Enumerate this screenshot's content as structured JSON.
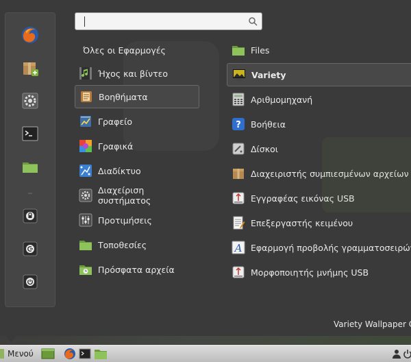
{
  "search": {
    "value": "",
    "placeholder": ""
  },
  "favorites": [
    {
      "name": "firefox-icon"
    },
    {
      "name": "software-manager-icon"
    },
    {
      "name": "system-settings-icon"
    },
    {
      "name": "terminal-icon"
    },
    {
      "name": "folder-icon"
    },
    {
      "name": "lock-screen-icon"
    },
    {
      "name": "logout-icon"
    },
    {
      "name": "shutdown-icon"
    }
  ],
  "categories": [
    {
      "label": "Όλες οι Εφαρμογές",
      "icon": ""
    },
    {
      "label": "Ήχος και βίντεο",
      "icon": "multimedia-icon"
    },
    {
      "label": "Βοηθήματα",
      "icon": "accessories-icon"
    },
    {
      "label": "Γραφείο",
      "icon": "office-icon"
    },
    {
      "label": "Γραφικά",
      "icon": "graphics-icon"
    },
    {
      "label": "Διαδίκτυο",
      "icon": "internet-icon"
    },
    {
      "label": "Διαχείριση συστήματος",
      "icon": "administration-icon"
    },
    {
      "label": "Προτιμήσεις",
      "icon": "preferences-icon"
    },
    {
      "label": "Τοποθεσίες",
      "icon": "places-folder-icon"
    },
    {
      "label": "Πρόσφατα αρχεία",
      "icon": "recent-files-icon"
    }
  ],
  "selected_category": "Βοηθήματα",
  "apps": [
    {
      "label": "Files",
      "icon": "folder-icon"
    },
    {
      "label": "Variety",
      "icon": "variety-icon"
    },
    {
      "label": "Αριθμομηχανή",
      "icon": "calculator-icon"
    },
    {
      "label": "Βοήθεια",
      "icon": "help-icon"
    },
    {
      "label": "Δίσκοι",
      "icon": "disks-icon"
    },
    {
      "label": "Διαχειριστής συμπιεσμένων αρχείων",
      "icon": "archive-manager-icon"
    },
    {
      "label": "Εγγραφέας εικόνας USB",
      "icon": "usb-image-writer-icon"
    },
    {
      "label": "Επεξεργαστής κειμένου",
      "icon": "text-editor-icon"
    },
    {
      "label": "Εφαρμογή προβολής γραμματοσειρών",
      "icon": "font-viewer-icon"
    },
    {
      "label": "Μορφοποιητής μνήμης USB",
      "icon": "usb-stick-formatter-icon"
    }
  ],
  "selected_app": "Variety",
  "app_description": "Variety Wallpaper C",
  "panel": {
    "menu_label": "Μενού",
    "launchers": [
      "show-desktop-icon",
      "firefox-icon",
      "terminal-icon",
      "folder-icon"
    ],
    "tray": [
      "user-icon",
      "power-icon"
    ]
  },
  "colors": {
    "menu_bg": "#3a3a3a",
    "selection_bg": "#474747",
    "panel_bg": "#cfcfcf",
    "accent_green": "#8fb35f"
  }
}
